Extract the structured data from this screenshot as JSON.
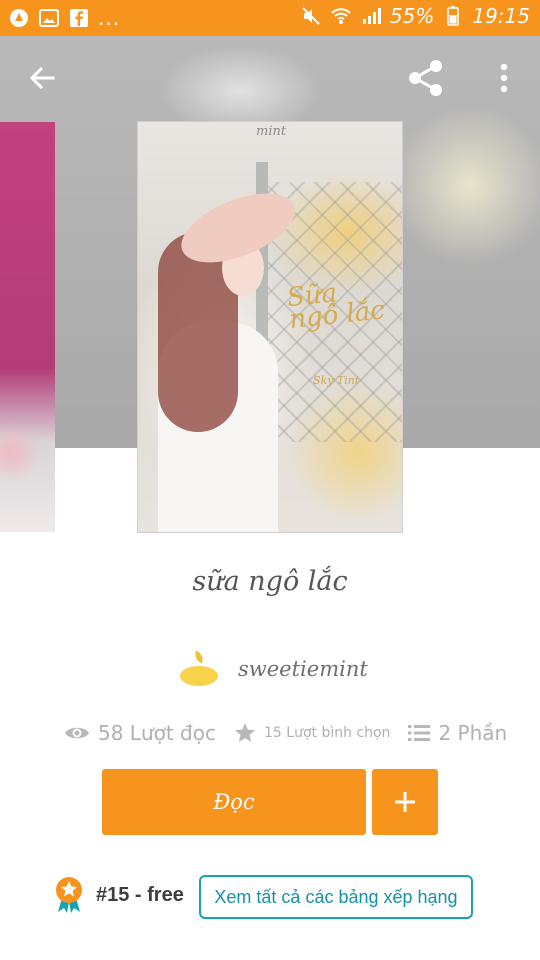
{
  "status_bar": {
    "left_more": "...",
    "battery_text": "55%",
    "time": "19:15",
    "icons": [
      "app-icon",
      "gallery-icon",
      "facebook-icon",
      "mute-icon",
      "wifi-icon",
      "signal-icon",
      "battery-icon"
    ]
  },
  "toolbar": {
    "back_icon": "arrow-left-icon",
    "share_icon": "share-icon",
    "more_icon": "more-vertical-icon"
  },
  "cover": {
    "mark": "mint",
    "script_title": "Sữa ngô lắc",
    "script_sub": "Sky Tint"
  },
  "story": {
    "title": "sữa ngô lắc",
    "author": "sweetiemint",
    "reads": "58 Lượt đọc",
    "votes": "15 Lượt bình chọn",
    "parts": "2 Phần"
  },
  "actions": {
    "read_label": "Đọc",
    "add_icon": "plus-icon"
  },
  "ranking": {
    "rank_text": "#15 - free",
    "link_label": "Xem tất cả các bảng xếp hạng"
  },
  "colors": {
    "accent": "#f7941d",
    "link": "#17a2b8",
    "muted_text": "#b0b0b0"
  }
}
